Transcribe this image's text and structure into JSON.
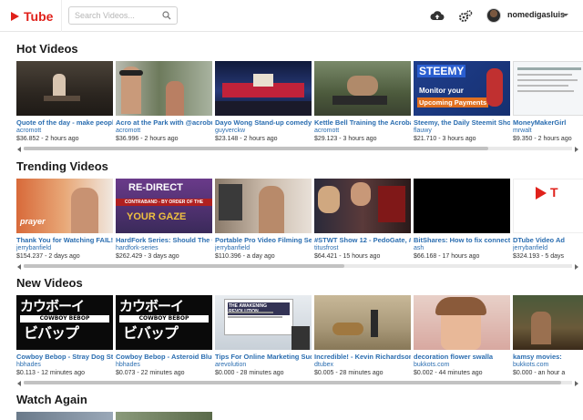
{
  "app": {
    "logo_text": "Tube"
  },
  "search": {
    "placeholder": "Search Videos..."
  },
  "header": {
    "username": "nomedigasluis"
  },
  "sections": [
    {
      "title": "Hot Videos",
      "scroll_position": 0.0,
      "scroll_visible_fraction": 0.83,
      "cards": [
        {
          "title": "Quote of the day - make people",
          "author": "acromott",
          "meta": "$36.852 - 2 hours ago"
        },
        {
          "title": "Acro at the Park with @acrobu",
          "author": "acromott",
          "meta": "$36.996 - 2 hours ago"
        },
        {
          "title": "Dayo Wong Stand-up comedy",
          "author": "guyverckw",
          "meta": "$23.148 - 2 hours ago"
        },
        {
          "title": "Kettle Bell Training the Acrobat",
          "author": "acromott",
          "meta": "$29.123 - 3 hours ago"
        },
        {
          "title": "Steemy, the Daily Steemit Show",
          "author": "flauwy",
          "meta": "$21.710 - 3 hours ago",
          "overlay": "STEEMY",
          "overlay2": "Monitor your",
          "overlay3": "Upcoming Payments"
        },
        {
          "title": "MoneyMakerGirl",
          "author": "mrwalt",
          "meta": "$9.350 - 2 hours ago"
        }
      ]
    },
    {
      "title": "Trending Videos",
      "scroll_position": 0.0,
      "scroll_visible_fraction": 0.6,
      "cards": [
        {
          "title": "Thank You for Watching FAIL!",
          "author": "jerrybanfield",
          "meta": "$154.237 - 2 days ago",
          "overlay": "prayer"
        },
        {
          "title": "HardFork Series: Should The O",
          "author": "hardfork-series",
          "meta": "$262.429 - 3 days ago",
          "overlay": "RE-DIRECT",
          "overlay2": "CONTRABAND - BY ORDER OF THE",
          "overlay3": "YOUR GAZE"
        },
        {
          "title": "Portable Pro Video Filming Set",
          "author": "jerrybanfield",
          "meta": "$110.396 - a day ago"
        },
        {
          "title": "#STWT Show 12 - PedoGate, #1",
          "author": "titusfrost",
          "meta": "$64.421 - 15 hours ago"
        },
        {
          "title": "BitShares: How to fix connecti",
          "author": "ash",
          "meta": "$66.168 - 17 hours ago"
        },
        {
          "title": "DTube Video Ad",
          "author": "jerrybanfield",
          "meta": "$324.193 - 5 days"
        }
      ]
    },
    {
      "title": "New Videos",
      "scroll_position": 0.0,
      "scroll_visible_fraction": 0.97,
      "cards": [
        {
          "title": "Cowboy Bebop - Stray Dog Strut",
          "author": "hbhades",
          "meta": "$0.113 - 12 minutes ago",
          "overlay": "カウボーイ",
          "overlay2": "COWBOY BEBOP",
          "overlay3": "ビバップ"
        },
        {
          "title": "Cowboy Bebop - Asteroid Blues",
          "author": "hbhades",
          "meta": "$0.073 - 22 minutes ago",
          "overlay": "カウボーイ",
          "overlay2": "COWBOY BEBOP",
          "overlay3": "ビバップ"
        },
        {
          "title": "Tips For Online Marketing Succ",
          "author": "arevolution",
          "meta": "$0.000 - 28 minutes ago",
          "overlay": "THE AWAKENING REVOLUTION"
        },
        {
          "title": "Incredible! - Kevin Richardson",
          "author": "dtubex",
          "meta": "$0.005 - 28 minutes ago"
        },
        {
          "title": "decoration flower swalla",
          "author": "bukkots.com",
          "meta": "$0.002 - 44 minutes ago"
        },
        {
          "title": "kamsy movies:",
          "author": "bukkots.com",
          "meta": "$0.000 - an hour a"
        }
      ]
    },
    {
      "title": "Watch Again",
      "cards": []
    }
  ],
  "colors": {
    "brand": "#e0211b",
    "link": "#2a6db0"
  },
  "icons": [
    "search-icon",
    "upload-icon",
    "settings-icon",
    "avatar",
    "chevron-down-icon"
  ]
}
